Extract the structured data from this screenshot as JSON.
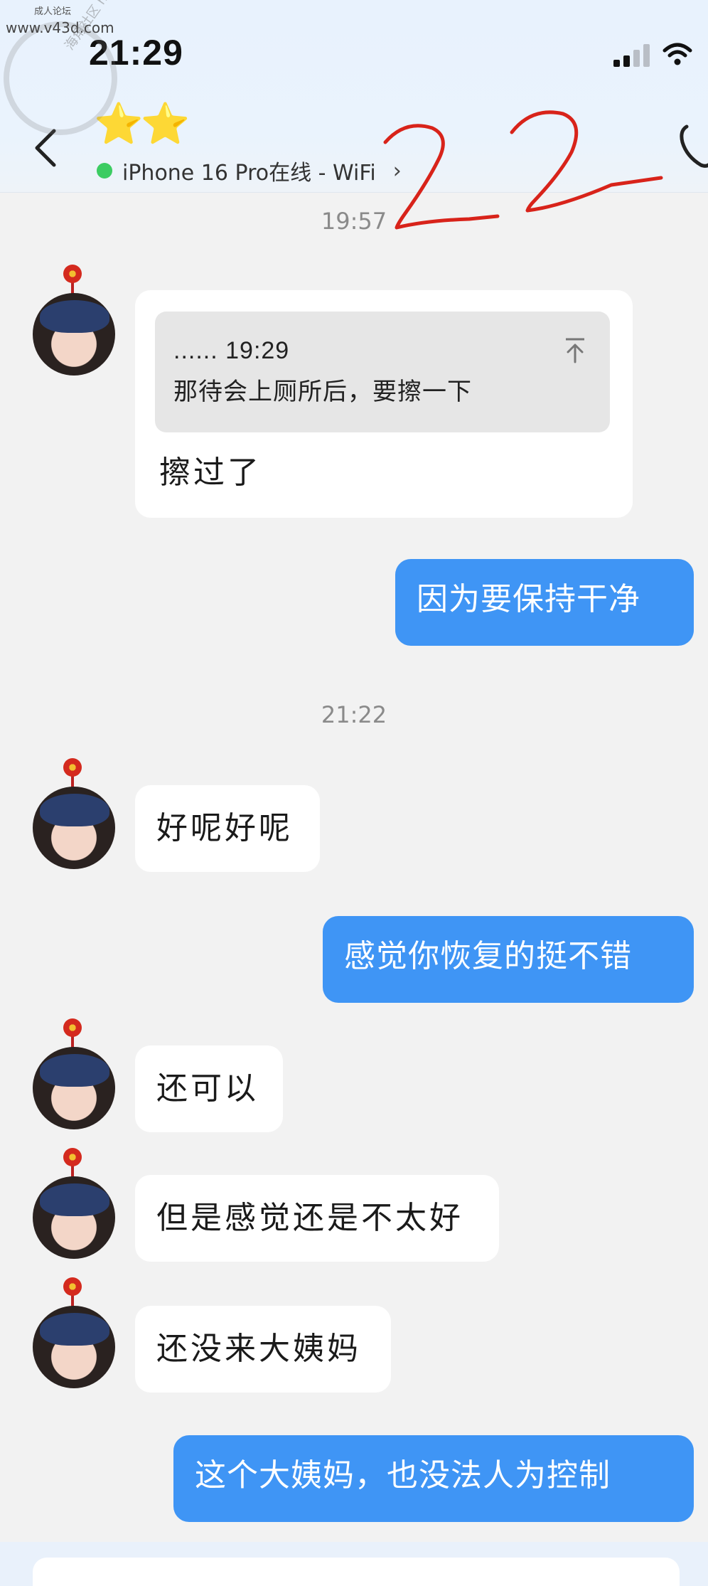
{
  "status_bar": {
    "time": "21:29"
  },
  "watermark": {
    "top_text": "成人论坛",
    "url": "www.v43d.com",
    "ring_text": "海角社区 haijiao.com"
  },
  "header": {
    "title_emoji": "⭐⭐",
    "presence_text": "iPhone 16 Pro在线 - WiFi",
    "presence_chevron": "›",
    "annotation": "22"
  },
  "messages": {
    "ts1": "19:57",
    "quote_meta": "...... 19:29",
    "quote_text": "那待会上厕所后，要擦一下",
    "m1": "擦过了",
    "m2": "因为要保持干净",
    "ts2": "21:22",
    "m3": "好呢好呢",
    "m4": "感觉你恢复的挺不错",
    "m5": "还可以",
    "m6": "但是感觉还是不太好",
    "m7": "还没来大姨妈",
    "m8": "这个大姨妈，也没法人为控制"
  },
  "colors": {
    "outgoing_bubble": "#3f95f5",
    "incoming_bubble": "#ffffff",
    "background": "#f2f2f2",
    "online_dot": "#3ccc62",
    "annotation_ink": "#d8231a"
  }
}
